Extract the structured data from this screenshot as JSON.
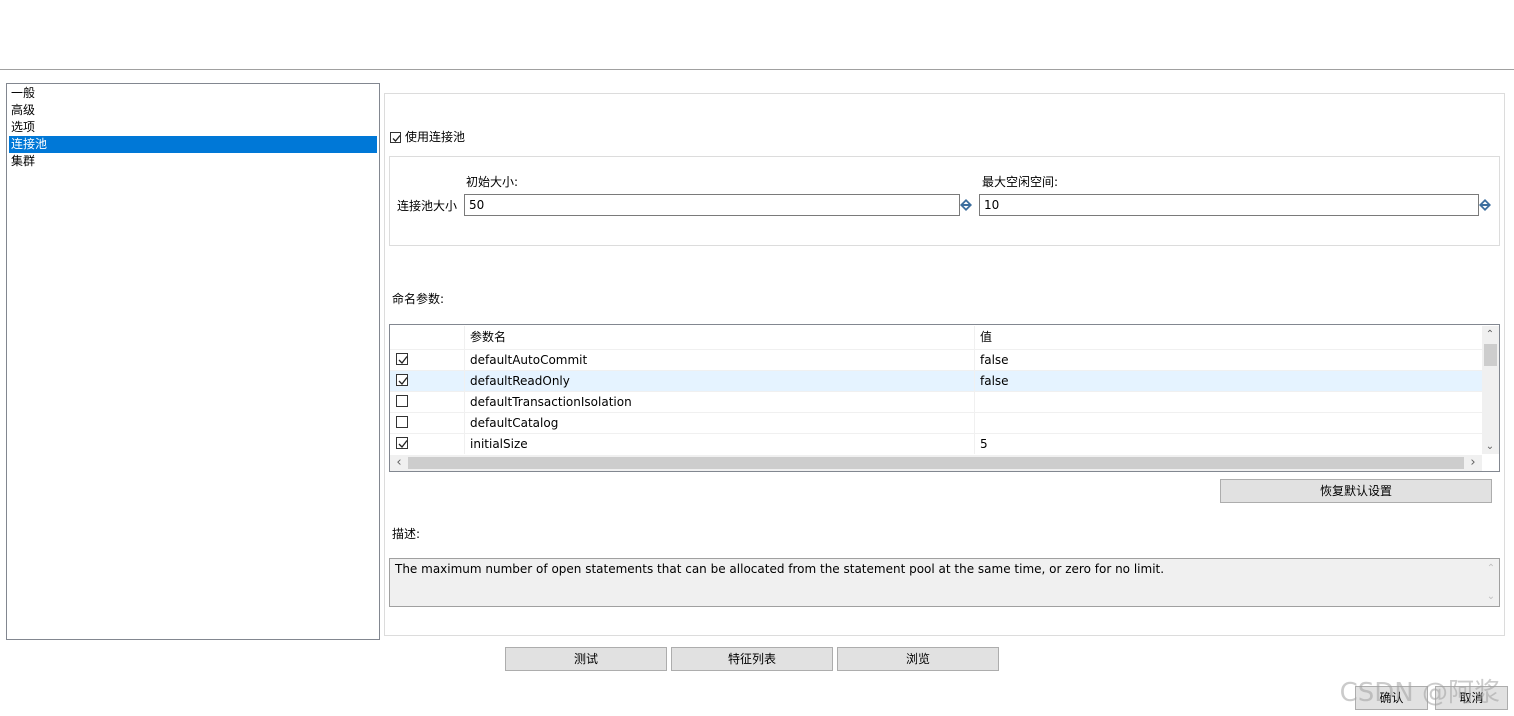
{
  "nav": {
    "items": [
      {
        "label": "一般"
      },
      {
        "label": "高级"
      },
      {
        "label": "选项"
      },
      {
        "label": "连接池",
        "selected": true
      },
      {
        "label": "集群"
      }
    ]
  },
  "pool": {
    "use_pool_label": "使用连接池",
    "use_pool_checked": true,
    "size_label": "连接池大小",
    "initial_size_label": "初始大小:",
    "initial_size_value": "50",
    "max_idle_label": "最大空闲空间:",
    "max_idle_value": "10"
  },
  "params": {
    "section_label": "命名参数:",
    "col_name": "参数名",
    "col_value": "值",
    "rows": [
      {
        "checked": true,
        "name": "defaultAutoCommit",
        "value": "false"
      },
      {
        "checked": true,
        "name": "defaultReadOnly",
        "value": "false"
      },
      {
        "checked": false,
        "name": "defaultTransactionIsolation",
        "value": ""
      },
      {
        "checked": false,
        "name": "defaultCatalog",
        "value": ""
      },
      {
        "checked": true,
        "name": "initialSize",
        "value": "5"
      }
    ],
    "restore_default_label": "恢复默认设置"
  },
  "description": {
    "label": "描述:",
    "text": "The maximum number of open statements that can be allocated from the statement pool at the same time, or zero for no limit."
  },
  "buttons": {
    "test": "测试",
    "feature_list": "特征列表",
    "browse": "浏览",
    "ok": "确认",
    "cancel": "取消"
  },
  "watermark": "CSDN @阿浆",
  "colors": {
    "selection": "#0078d7",
    "row_highlight": "#e5f3ff",
    "button_face": "#e1e1e1"
  }
}
